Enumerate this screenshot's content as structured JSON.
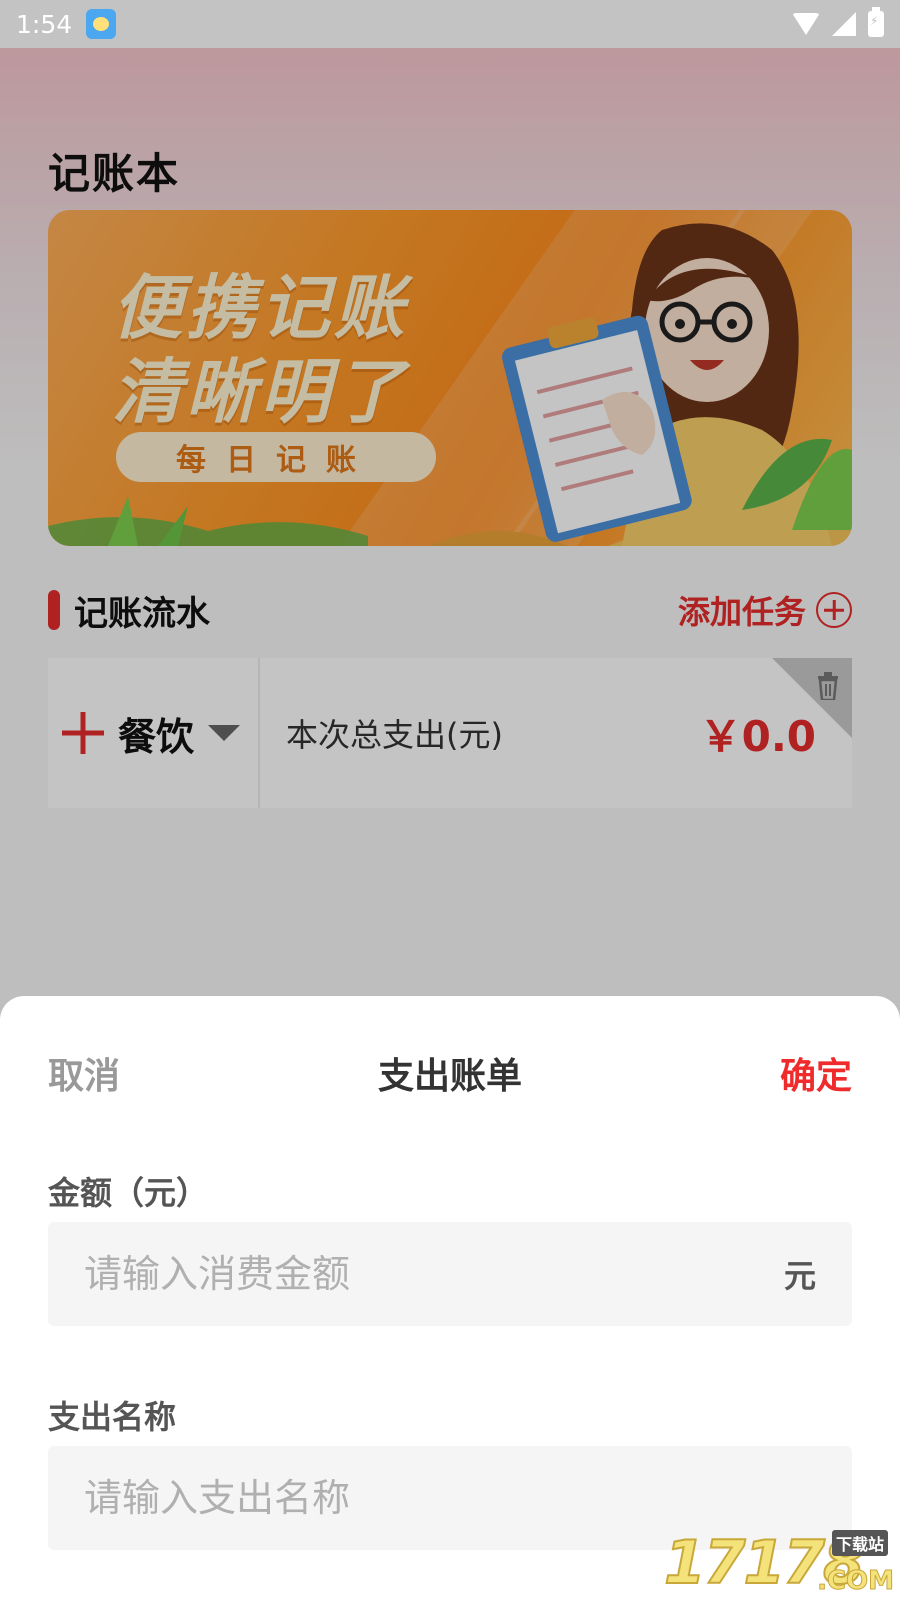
{
  "status_bar": {
    "time": "1:54"
  },
  "page": {
    "title": "记账本",
    "banner": {
      "line1": "便携记账",
      "line2": "清晰明了",
      "pill": "每日记账"
    },
    "section": {
      "title": "记账流水",
      "add_task_label": "添加任务"
    },
    "record": {
      "category": "餐饮",
      "total_label": "本次总支出(元)",
      "total_value": "￥0.0"
    }
  },
  "sheet": {
    "cancel_label": "取消",
    "title": "支出账单",
    "confirm_label": "确定",
    "amount_label": "金额（元）",
    "amount_placeholder": "请输入消费金额",
    "amount_unit": "元",
    "name_label": "支出名称",
    "name_placeholder": "请输入支出名称"
  },
  "watermark": {
    "digits": "17178",
    "sub": "下载站",
    "com": ".COM"
  },
  "colors": {
    "accent_red": "#e62b2b",
    "confirm_red": "#f02b2b",
    "banner_orange": "#ff8a1c"
  }
}
